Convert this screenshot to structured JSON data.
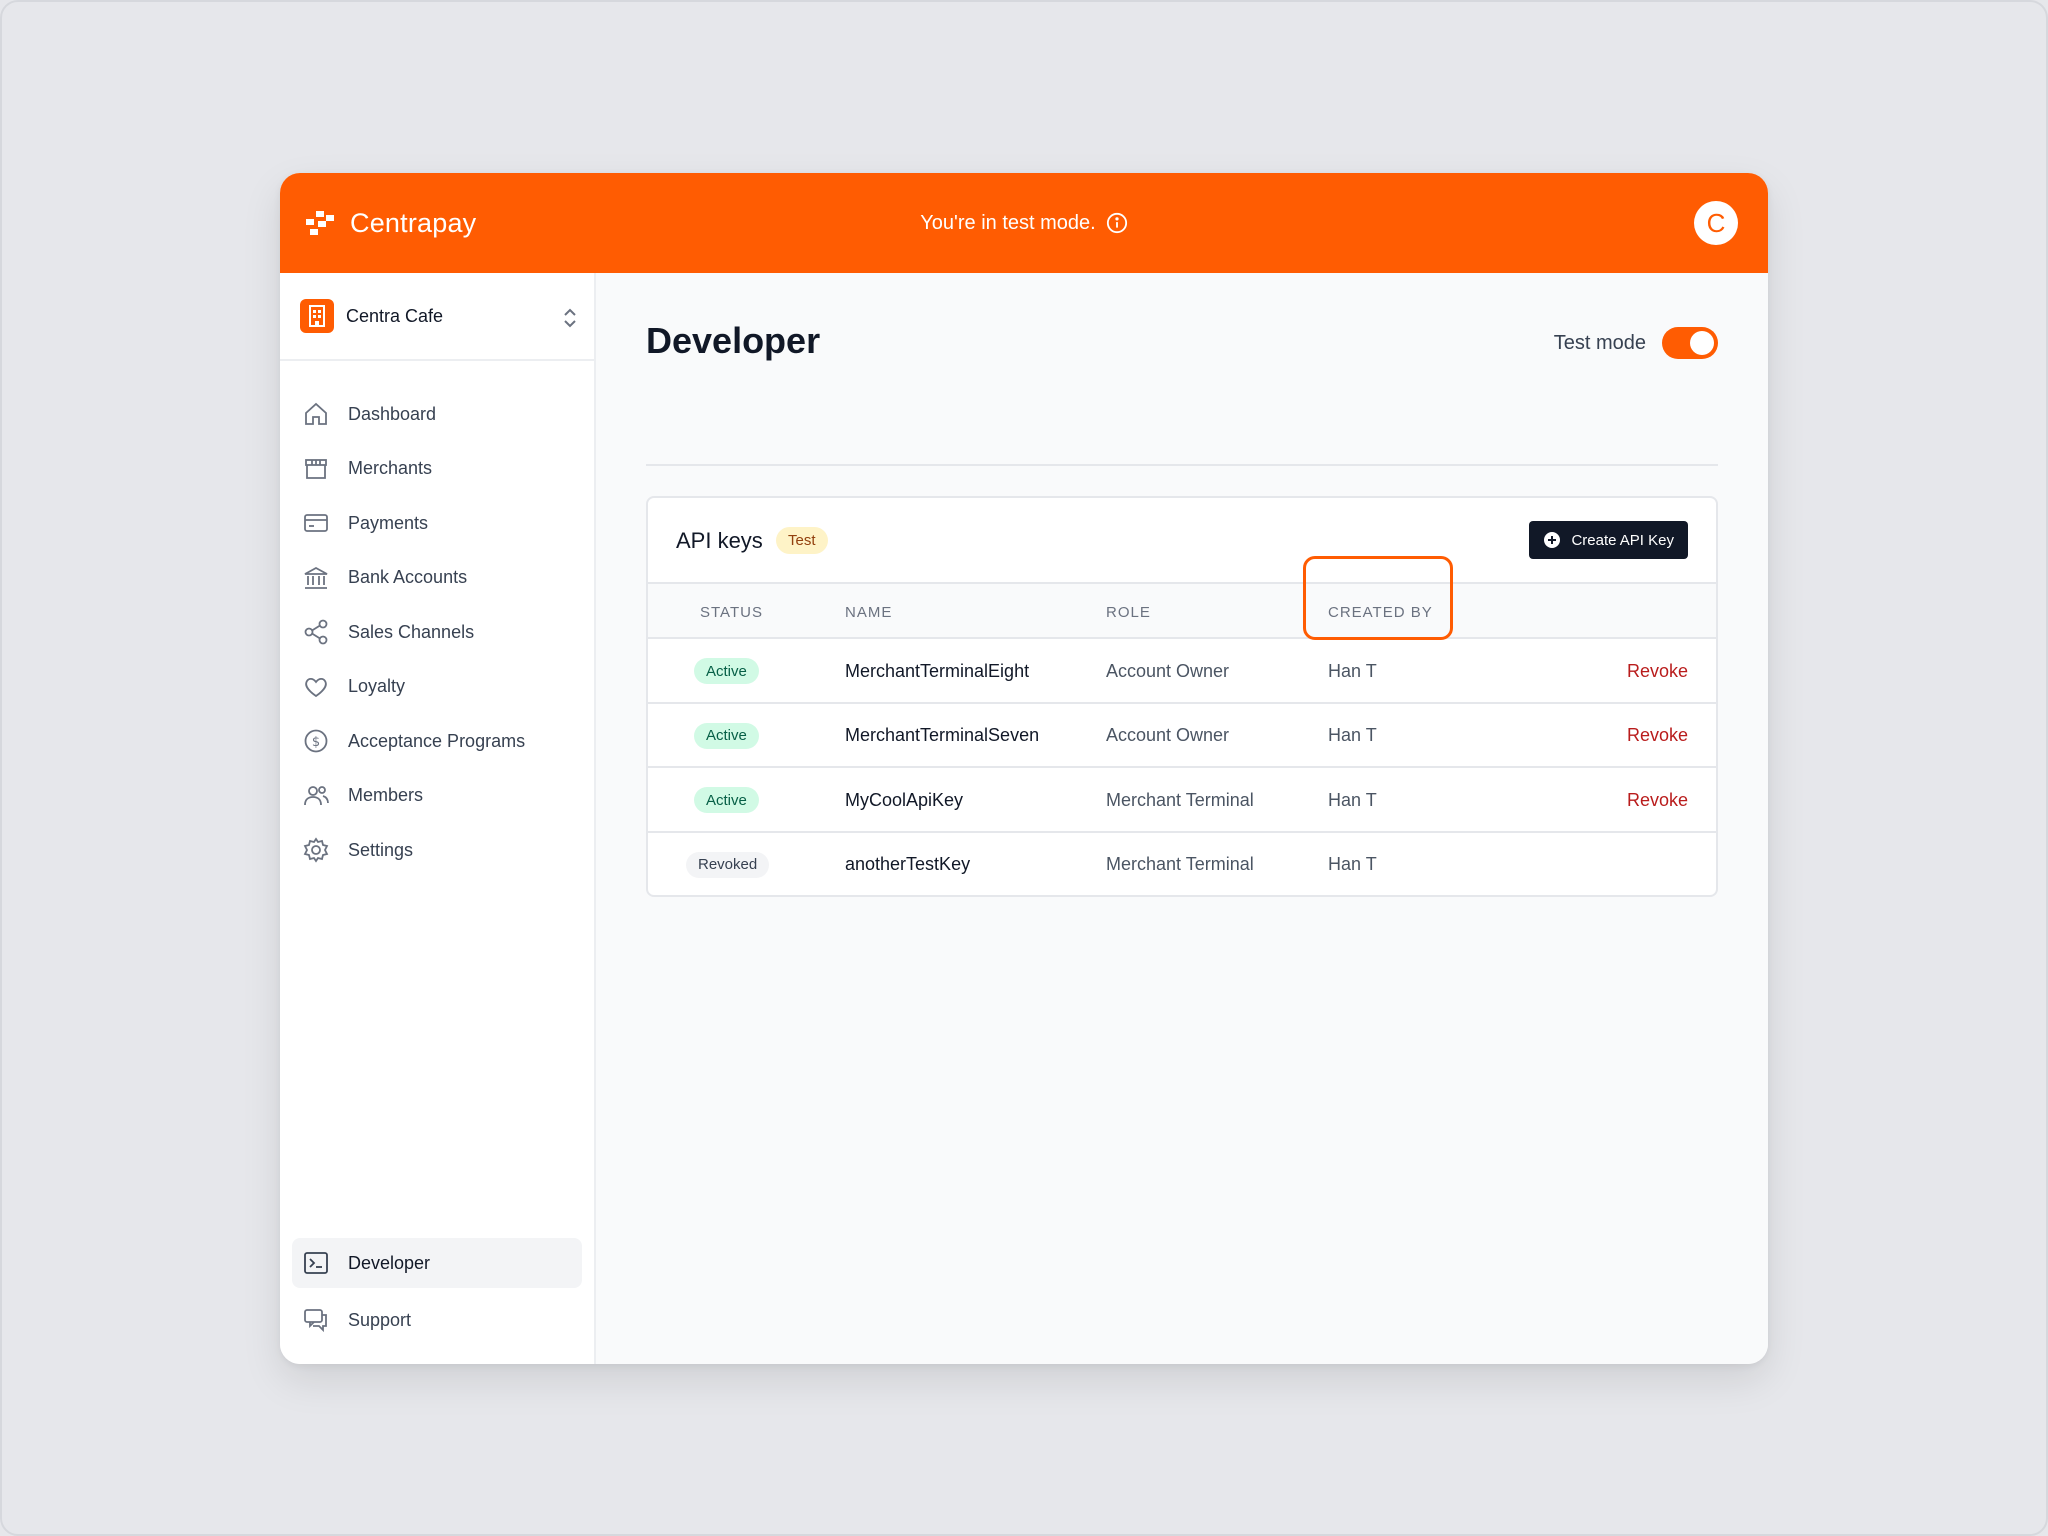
{
  "brand": {
    "name": "Centrapay"
  },
  "banner": {
    "text": "You're in test mode."
  },
  "user": {
    "avatar_letter": "C"
  },
  "org": {
    "name": "Centra Cafe"
  },
  "nav": {
    "items": [
      {
        "label": "Dashboard",
        "icon": "home-icon"
      },
      {
        "label": "Merchants",
        "icon": "store-icon"
      },
      {
        "label": "Payments",
        "icon": "credit-card-icon"
      },
      {
        "label": "Bank Accounts",
        "icon": "bank-icon"
      },
      {
        "label": "Sales Channels",
        "icon": "share-icon"
      },
      {
        "label": "Loyalty",
        "icon": "heart-icon"
      },
      {
        "label": "Acceptance Programs",
        "icon": "dollar-circle-icon"
      },
      {
        "label": "Members",
        "icon": "users-icon"
      },
      {
        "label": "Settings",
        "icon": "gear-icon"
      }
    ],
    "bottom": [
      {
        "label": "Developer",
        "icon": "terminal-icon",
        "active": true
      },
      {
        "label": "Support",
        "icon": "chat-icon"
      }
    ]
  },
  "page": {
    "title": "Developer",
    "test_mode_label": "Test mode",
    "test_mode_on": true
  },
  "api_keys": {
    "title": "API keys",
    "tag": "Test",
    "create_label": "Create API Key",
    "columns": [
      "STATUS",
      "NAME",
      "ROLE",
      "CREATED BY"
    ],
    "rows": [
      {
        "status": "Active",
        "name": "MerchantTerminalEight",
        "role": "Account Owner",
        "created_by": "Han T",
        "action": "Revoke"
      },
      {
        "status": "Active",
        "name": "MerchantTerminalSeven",
        "role": "Account Owner",
        "created_by": "Han T",
        "action": "Revoke"
      },
      {
        "status": "Active",
        "name": "MyCoolApiKey",
        "role": "Merchant Terminal",
        "created_by": "Han T",
        "action": "Revoke"
      },
      {
        "status": "Revoked",
        "name": "anotherTestKey",
        "role": "Merchant Terminal",
        "created_by": "Han T",
        "action": ""
      }
    ]
  },
  "colors": {
    "brand": "#ff5c02",
    "active_badge": "#d1fae5",
    "revoke": "#b91c1c",
    "primary_button": "#111827"
  }
}
